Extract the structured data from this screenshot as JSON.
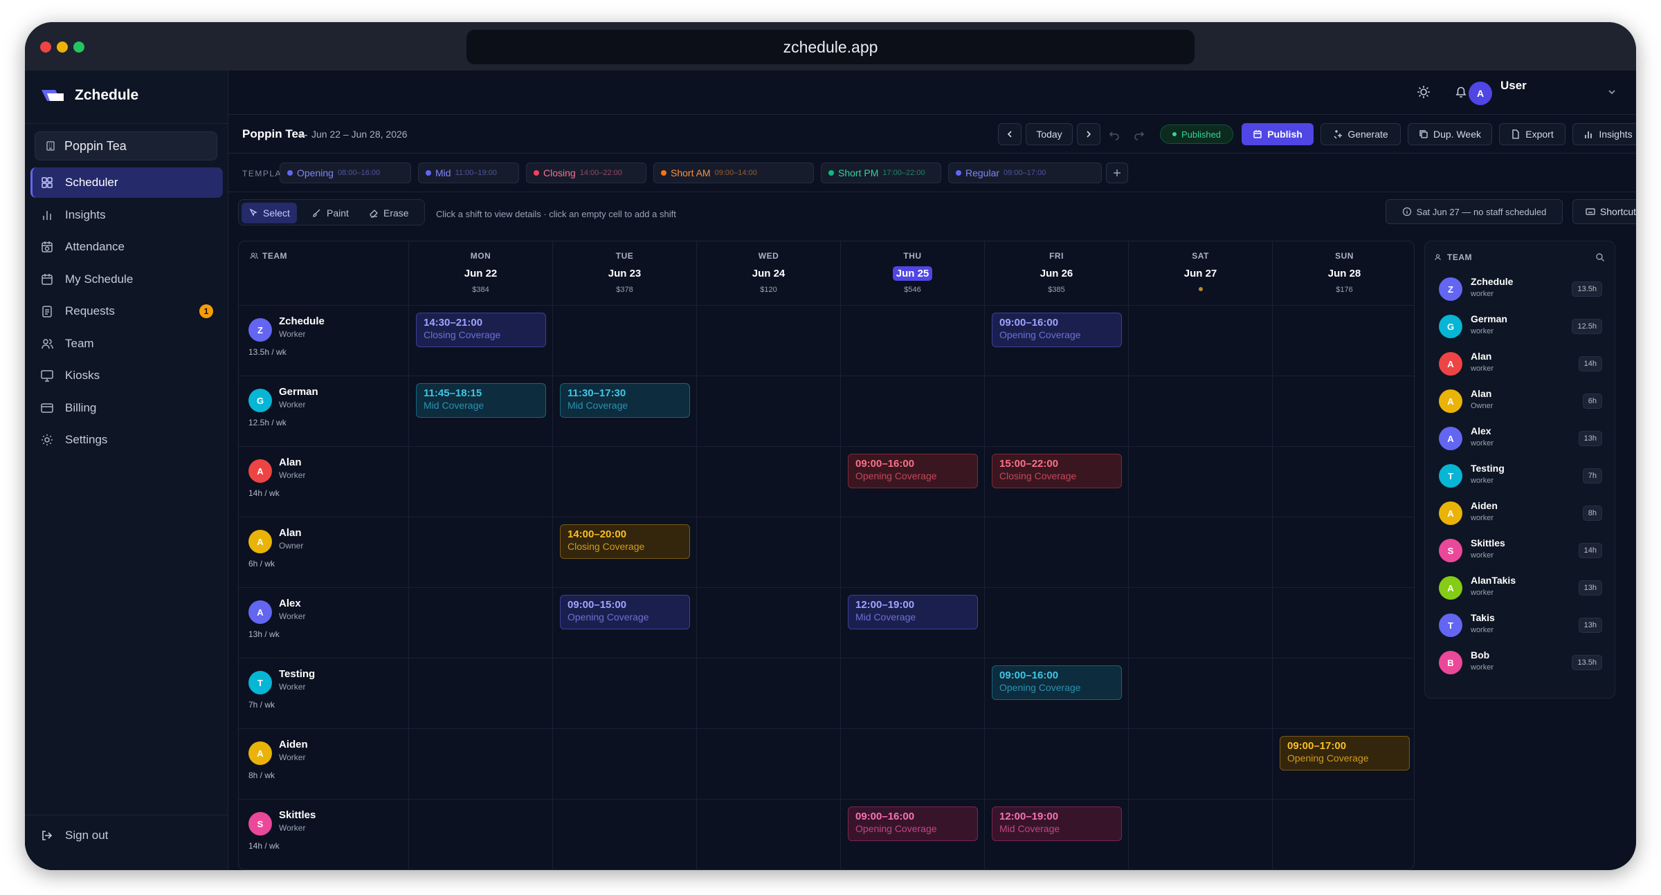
{
  "window": {
    "url": "zchedule.app"
  },
  "sidebar": {
    "brand": "Zchedule",
    "org": "Poppin Tea",
    "items": [
      {
        "label": "Scheduler",
        "icon": "grid-icon",
        "active": true
      },
      {
        "label": "Insights",
        "icon": "bar-chart-icon"
      },
      {
        "label": "Attendance",
        "icon": "calendar-clock-icon"
      },
      {
        "label": "My Schedule",
        "icon": "calendar-icon"
      },
      {
        "label": "Requests",
        "icon": "clipboard-icon",
        "badge": "1"
      },
      {
        "label": "Team",
        "icon": "users-icon"
      },
      {
        "label": "Kiosks",
        "icon": "monitor-icon"
      },
      {
        "label": "Billing",
        "icon": "credit-card-icon"
      },
      {
        "label": "Settings",
        "icon": "gear-icon"
      }
    ],
    "signout": "Sign out"
  },
  "header": {
    "user_initial": "A",
    "user_name": "User"
  },
  "toolbar": {
    "title": "Poppin Tea",
    "range": "Jun 22 – Jun 28, 2026",
    "today": "Today",
    "published": "Published",
    "publish": "Publish",
    "generate": "Generate",
    "dup_week": "Dup. Week",
    "export": "Export",
    "insights": "Insights"
  },
  "templates": {
    "label": "TEMPLATES",
    "items": [
      {
        "name": "Opening",
        "time": "08:00–16:00",
        "color": "#6366f1"
      },
      {
        "name": "Mid",
        "time": "11:00–19:00",
        "color": "#6366f1"
      },
      {
        "name": "Closing",
        "time": "14:00–22:00",
        "color": "#f43f5e"
      },
      {
        "name": "Short AM",
        "time": "09:00–14:00",
        "color": "#f97316"
      },
      {
        "name": "Short PM",
        "time": "17:00–22:00",
        "color": "#10b981"
      },
      {
        "name": "Regular",
        "time": "09:00–17:00",
        "color": "#6366f1"
      }
    ]
  },
  "modes": {
    "select": "Select",
    "paint": "Paint",
    "erase": "Erase",
    "hint": "Click a shift to view details · click an empty cell to add a shift",
    "alert": "Sat Jun 27 — no staff scheduled",
    "shortcuts": "Shortcuts"
  },
  "grid": {
    "team_label": "TEAM",
    "days": [
      {
        "dow": "MON",
        "date": "Jun 22",
        "cost": "$384"
      },
      {
        "dow": "TUE",
        "date": "Jun 23",
        "cost": "$378"
      },
      {
        "dow": "WED",
        "date": "Jun 24",
        "cost": "$120"
      },
      {
        "dow": "THU",
        "date": "Jun 25",
        "cost": "$546",
        "today": true
      },
      {
        "dow": "FRI",
        "date": "Jun 26",
        "cost": "$385"
      },
      {
        "dow": "SAT",
        "date": "Jun 27",
        "cost": "",
        "no_staff": true
      },
      {
        "dow": "SUN",
        "date": "Jun 28",
        "cost": "$176"
      }
    ],
    "rows": [
      {
        "initial": "Z",
        "name": "Zchedule",
        "role": "Worker",
        "hours": "13.5h / wk",
        "color": "#6366f1",
        "shifts": [
          {
            "day": 0,
            "time": "14:30–21:00",
            "label": "Closing Coverage",
            "style": "indigo"
          },
          {
            "day": 4,
            "time": "09:00–16:00",
            "label": "Opening Coverage",
            "style": "indigo"
          }
        ]
      },
      {
        "initial": "G",
        "name": "German",
        "role": "Worker",
        "hours": "12.5h / wk",
        "color": "#06b6d4",
        "shifts": [
          {
            "day": 0,
            "time": "11:45–18:15",
            "label": "Mid Coverage",
            "style": "cyan"
          },
          {
            "day": 1,
            "time": "11:30–17:30",
            "label": "Mid Coverage",
            "style": "cyan"
          }
        ]
      },
      {
        "initial": "A",
        "name": "Alan",
        "role": "Worker",
        "hours": "14h / wk",
        "color": "#ef4444",
        "shifts": [
          {
            "day": 3,
            "time": "09:00–16:00",
            "label": "Opening Coverage",
            "style": "red"
          },
          {
            "day": 4,
            "time": "15:00–22:00",
            "label": "Closing Coverage",
            "style": "red"
          }
        ]
      },
      {
        "initial": "A",
        "name": "Alan",
        "role": "Owner",
        "hours": "6h / wk",
        "color": "#eab308",
        "shifts": [
          {
            "day": 1,
            "time": "14:00–20:00",
            "label": "Closing Coverage",
            "style": "amber"
          }
        ]
      },
      {
        "initial": "A",
        "name": "Alex",
        "role": "Worker",
        "hours": "13h / wk",
        "color": "#6366f1",
        "shifts": [
          {
            "day": 1,
            "time": "09:00–15:00",
            "label": "Opening Coverage",
            "style": "indigo"
          },
          {
            "day": 3,
            "time": "12:00–19:00",
            "label": "Mid Coverage",
            "style": "indigo"
          }
        ]
      },
      {
        "initial": "T",
        "name": "Testing",
        "role": "Worker",
        "hours": "7h / wk",
        "color": "#06b6d4",
        "shifts": [
          {
            "day": 4,
            "time": "09:00–16:00",
            "label": "Opening Coverage",
            "style": "cyan"
          }
        ]
      },
      {
        "initial": "A",
        "name": "Aiden",
        "role": "Worker",
        "hours": "8h / wk",
        "color": "#eab308",
        "shifts": [
          {
            "day": 6,
            "time": "09:00–17:00",
            "label": "Opening Coverage",
            "style": "amber"
          }
        ]
      },
      {
        "initial": "S",
        "name": "Skittles",
        "role": "Worker",
        "hours": "14h / wk",
        "color": "#ec4899",
        "shifts": [
          {
            "day": 3,
            "time": "09:00–16:00",
            "label": "Opening Coverage",
            "style": "pink"
          },
          {
            "day": 4,
            "time": "12:00–19:00",
            "label": "Mid Coverage",
            "style": "pink"
          }
        ]
      }
    ]
  },
  "team_panel": {
    "title": "TEAM",
    "members": [
      {
        "initial": "Z",
        "name": "Zchedule",
        "role": "worker",
        "hours": "13.5h",
        "color": "#6366f1"
      },
      {
        "initial": "G",
        "name": "German",
        "role": "worker",
        "hours": "12.5h",
        "color": "#06b6d4"
      },
      {
        "initial": "A",
        "name": "Alan",
        "role": "worker",
        "hours": "14h",
        "color": "#ef4444"
      },
      {
        "initial": "A",
        "name": "Alan",
        "role": "Owner",
        "hours": "6h",
        "color": "#eab308"
      },
      {
        "initial": "A",
        "name": "Alex",
        "role": "worker",
        "hours": "13h",
        "color": "#6366f1"
      },
      {
        "initial": "T",
        "name": "Testing",
        "role": "worker",
        "hours": "7h",
        "color": "#06b6d4"
      },
      {
        "initial": "A",
        "name": "Aiden",
        "role": "worker",
        "hours": "8h",
        "color": "#eab308"
      },
      {
        "initial": "S",
        "name": "Skittles",
        "role": "worker",
        "hours": "14h",
        "color": "#ec4899"
      },
      {
        "initial": "A",
        "name": "AlanTakis",
        "role": "worker",
        "hours": "13h",
        "color": "#84cc16"
      },
      {
        "initial": "T",
        "name": "Takis",
        "role": "worker",
        "hours": "13h",
        "color": "#6366f1"
      },
      {
        "initial": "B",
        "name": "Bob",
        "role": "worker",
        "hours": "13.5h",
        "color": "#ec4899"
      }
    ]
  }
}
